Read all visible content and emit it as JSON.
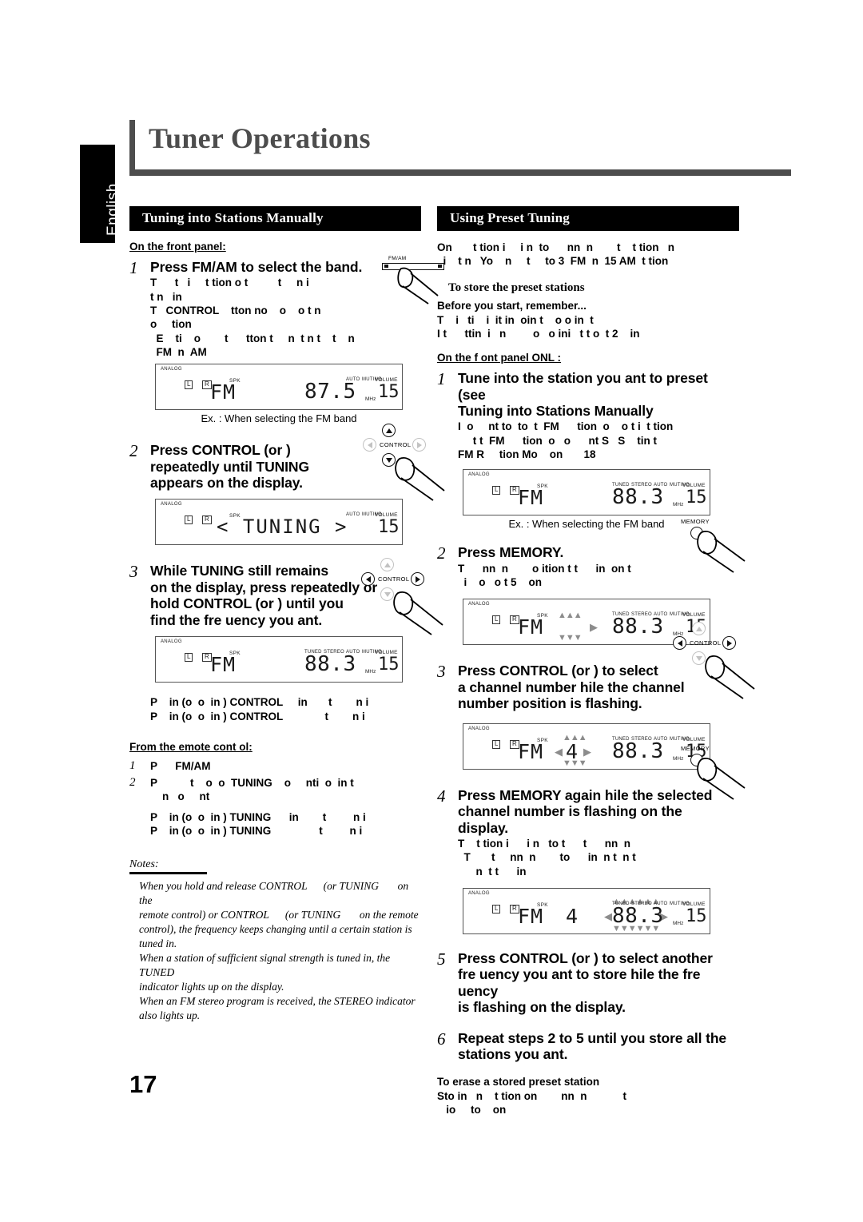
{
  "page": {
    "title": "Tuner Operations",
    "language_tab": "English",
    "page_number": "17"
  },
  "left_column": {
    "section_title": "Tuning into Stations Manually",
    "front_panel_label": "On the front panel:",
    "steps": [
      {
        "num": "1",
        "head": "Press FM/AM to select the band.",
        "body": "T      t   i     t tion o t          t     n i\nt n   in\nT   CONTROL    tton no    o    o t n\no     tion\n  E    ti    o        t      tton t     n  t n t    t    n\n  FM  n  AM"
      },
      {
        "num": "2",
        "head": "Press CONTROL   (or   )\nrepeatedly until   TUNING\nappears on the display.",
        "body": ""
      },
      {
        "num": "3",
        "head": "While    TUNING     still remains\non the display, press repeatedly or\nhold CONTROL    (or   ) until you\nfind the fre uency you   ant.",
        "body": ""
      }
    ],
    "press_fragments": [
      "P    in (o  o  in ) CONTROL     in       t        n i",
      "P    in (o  o  in ) CONTROL              t        n i"
    ],
    "remote_label": "From the  emote cont ol:",
    "remote_steps": [
      {
        "num": "1",
        "text": "P      FM/AM"
      },
      {
        "num": "2",
        "text": "P           t    o  o  TUNING    o     nti  o  in t\n    n   o     nt"
      }
    ],
    "remote_fragments": [
      "P    in (o  o  in ) TUNING      in        t         n i",
      "P    in (o  o  in ) TUNING                t         n i"
    ],
    "notes_label": "Notes:",
    "notes_body": "When you hold and release CONTROL      (or TUNING       on the\nremote control) or CONTROL      (or TUNING       on the remote\ncontrol), the frequency keeps changing until a certain station is\ntuned in.\nWhen a station of sufficient signal strength is tuned in, the TUNED\nindicator lights up on the display.\nWhen an FM stereo program is received, the STEREO indicator\nalso lights up.",
    "displays": {
      "step1": {
        "analog": "ANALOG",
        "left_ch": "L",
        "right_ch": "R",
        "spk": "SPK",
        "band": "FM",
        "channel": "",
        "frequency": "87.5",
        "indicators": {
          "tuned": "",
          "stereo": "",
          "auto": "AUTO",
          "muting": "MUTING"
        },
        "unit": "MHz",
        "volume_label": "VOLUME",
        "volume": "15",
        "caption": "Ex. : When selecting the FM band"
      },
      "step2": {
        "analog": "ANALOG",
        "left_ch": "L",
        "right_ch": "R",
        "spk": "SPK",
        "tuning_text": "< TUNING >",
        "indicators": {
          "auto": "AUTO",
          "muting": "MUTING"
        },
        "volume_label": "VOLUME",
        "volume": "15"
      },
      "step3": {
        "analog": "ANALOG",
        "left_ch": "L",
        "right_ch": "R",
        "spk": "SPK",
        "band": "FM",
        "channel": "",
        "frequency": "88.3",
        "indicators": {
          "tuned": "TUNED",
          "stereo": "STEREO",
          "auto": "AUTO",
          "muting": "MUTING"
        },
        "unit": "MHz",
        "volume_label": "VOLUME",
        "volume": "15"
      }
    },
    "buttons": {
      "fm_am": "FM/AM",
      "control": "CONTROL"
    }
  },
  "right_column": {
    "section_title": "Using Preset Tuning",
    "intro": "On       t tion i     i n  to      nn  n        t    t tion   n\n  i    t n   Yo    n     t     to 3  FM  n  15 AM  t tion",
    "store_heading": "To store the preset stations",
    "before_label": "Before you start, remember...",
    "before_body": "T    i   ti    i  it in  oin t    o o in  t\nI t      ttin  i   n         o   o ini   t t o  t 2    in",
    "front_panel_only_label": "On the f ont panel ONL :",
    "steps": [
      {
        "num": "1",
        "head": "Tune into the station you   ant to preset (see\nTuning into Stations Manually",
        "body": "I  o     nt to  to  t  FM      tion  o    o t i  t tion\n     t t  FM      tion  o   o      nt S   S    tin t\nFM R     tion Mo    on       18"
      },
      {
        "num": "2",
        "head": "Press MEMORY.",
        "body": "T      nn  n        o ition t t      in  on t\n  i    o   o t 5    on"
      },
      {
        "num": "3",
        "head": "Press CONTROL   (or   ) to select\na channel number    hile the channel\nnumber position is flashing.",
        "body": ""
      },
      {
        "num": "4",
        "head": "Press MEMORY again   hile the selected\nchannel number is flashing on the\ndisplay.",
        "body": "T    t tion i      i n   to t      t      nn  n\n  T       t     nn  n        to      in  n t  n t\n      n  t t      in"
      },
      {
        "num": "5",
        "head": "Press CONTROL   (or   ) to select another\nfre uency you   ant to store   hile the fre uency\nis flashing on the display.",
        "body": ""
      },
      {
        "num": "6",
        "head": "Repeat steps 2 to 5 until you store all the\nstations you   ant.",
        "body": ""
      }
    ],
    "erase_heading": "To erase a stored preset station",
    "erase_body": "Sto in   n    t tion on        nn  n            t\n   io     to    on",
    "displays": {
      "step1": {
        "analog": "ANALOG",
        "left_ch": "L",
        "right_ch": "R",
        "spk": "SPK",
        "band": "FM",
        "channel": "",
        "frequency": "88.3",
        "indicators": {
          "tuned": "TUNED",
          "stereo": "STEREO",
          "auto": "AUTO",
          "muting": "MUTING"
        },
        "unit": "MHz",
        "volume_label": "VOLUME",
        "volume": "15",
        "caption": "Ex. : When selecting the FM band"
      },
      "step2": {
        "analog": "ANALOG",
        "left_ch": "L",
        "right_ch": "R",
        "spk": "SPK",
        "band": "FM",
        "channel": "",
        "frequency": "88.3",
        "indicators": {
          "tuned": "TUNED",
          "stereo": "STEREO",
          "auto": "AUTO",
          "muting": "MUTING"
        },
        "unit": "MHz",
        "volume_label": "VOLUME",
        "volume": "15",
        "flashing": "channel-position"
      },
      "step3": {
        "analog": "ANALOG",
        "left_ch": "L",
        "right_ch": "R",
        "spk": "SPK",
        "band": "FM",
        "channel": "4",
        "frequency": "88.3",
        "indicators": {
          "tuned": "TUNED",
          "stereo": "STEREO",
          "auto": "AUTO",
          "muting": "MUTING"
        },
        "unit": "MHz",
        "volume_label": "VOLUME",
        "volume": "15",
        "flashing": "channel-number"
      },
      "step4": {
        "analog": "ANALOG",
        "left_ch": "L",
        "right_ch": "R",
        "spk": "SPK",
        "band": "FM",
        "channel": "4",
        "frequency": "88.3",
        "indicators": {
          "tuned": "TUNED",
          "stereo": "STEREO",
          "auto": "AUTO",
          "muting": "MUTING"
        },
        "unit": "MHz",
        "volume_label": "VOLUME",
        "volume": "15",
        "flashing": "frequency"
      }
    },
    "buttons": {
      "memory": "MEMORY",
      "control": "CONTROL"
    }
  }
}
